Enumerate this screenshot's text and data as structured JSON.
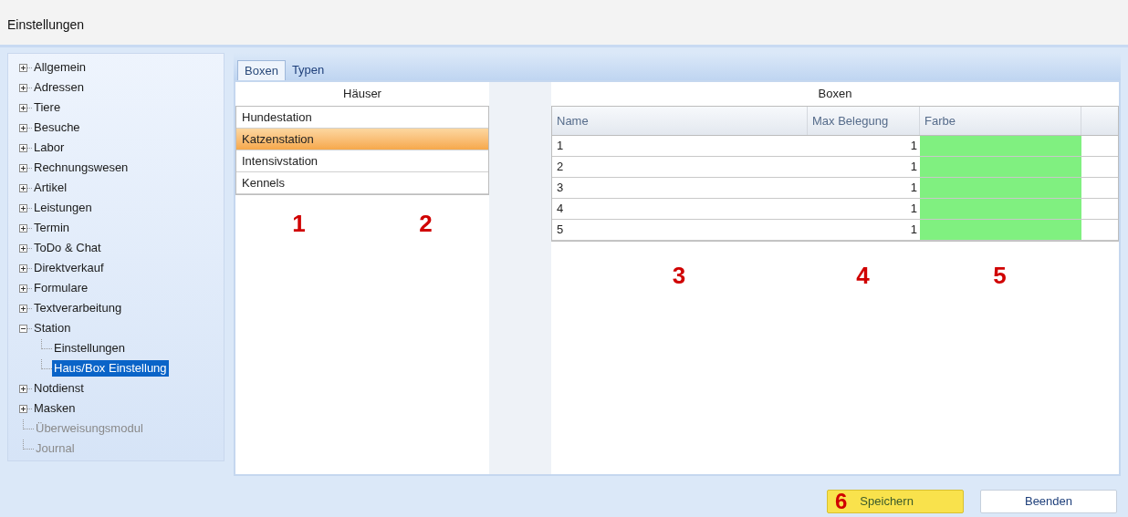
{
  "window": {
    "title": "Einstellungen"
  },
  "tree": [
    {
      "label": "Allgemein",
      "kind": "node",
      "expanded": false,
      "selected": false,
      "disabled": false
    },
    {
      "label": "Adressen",
      "kind": "node",
      "expanded": false,
      "selected": false,
      "disabled": false
    },
    {
      "label": "Tiere",
      "kind": "node",
      "expanded": false,
      "selected": false,
      "disabled": false
    },
    {
      "label": "Besuche",
      "kind": "node",
      "expanded": false,
      "selected": false,
      "disabled": false
    },
    {
      "label": "Labor",
      "kind": "node",
      "expanded": false,
      "selected": false,
      "disabled": false
    },
    {
      "label": "Rechnungswesen",
      "kind": "node",
      "expanded": false,
      "selected": false,
      "disabled": false
    },
    {
      "label": "Artikel",
      "kind": "node",
      "expanded": false,
      "selected": false,
      "disabled": false
    },
    {
      "label": "Leistungen",
      "kind": "node",
      "expanded": false,
      "selected": false,
      "disabled": false
    },
    {
      "label": "Termin",
      "kind": "node",
      "expanded": false,
      "selected": false,
      "disabled": false
    },
    {
      "label": "ToDo & Chat",
      "kind": "node",
      "expanded": false,
      "selected": false,
      "disabled": false
    },
    {
      "label": "Direktverkauf",
      "kind": "node",
      "expanded": false,
      "selected": false,
      "disabled": false
    },
    {
      "label": "Formulare",
      "kind": "node",
      "expanded": false,
      "selected": false,
      "disabled": false
    },
    {
      "label": "Textverarbeitung",
      "kind": "node",
      "expanded": false,
      "selected": false,
      "disabled": false
    },
    {
      "label": "Station",
      "kind": "node",
      "expanded": true,
      "selected": false,
      "disabled": false,
      "children": [
        {
          "label": "Einstellungen",
          "kind": "leaf",
          "selected": false,
          "disabled": false
        },
        {
          "label": "Haus/Box Einstellung",
          "kind": "leaf",
          "selected": true,
          "disabled": false
        }
      ]
    },
    {
      "label": "Notdienst",
      "kind": "node",
      "expanded": false,
      "selected": false,
      "disabled": false
    },
    {
      "label": "Masken",
      "kind": "node",
      "expanded": false,
      "selected": false,
      "disabled": false
    },
    {
      "label": "Überweisungsmodul",
      "kind": "leaf",
      "selected": false,
      "disabled": true
    },
    {
      "label": "Journal",
      "kind": "leaf",
      "selected": false,
      "disabled": true
    }
  ],
  "tabs": [
    {
      "label": "Boxen",
      "selected": true
    },
    {
      "label": "Typen",
      "selected": false
    }
  ],
  "houses": {
    "title": "Häuser",
    "rows": [
      {
        "name": "Hundestation",
        "selected": false
      },
      {
        "name": "Katzenstation",
        "selected": true
      },
      {
        "name": "Intensivstation",
        "selected": false
      },
      {
        "name": "Kennels",
        "selected": false
      }
    ],
    "annotations": [
      "1",
      "2"
    ]
  },
  "boxes": {
    "title": "Boxen",
    "columns": [
      "Name",
      "Max Belegung",
      "Farbe"
    ],
    "rows": [
      {
        "name": "1",
        "max": "1",
        "color": "#80f080"
      },
      {
        "name": "2",
        "max": "1",
        "color": "#80f080"
      },
      {
        "name": "3",
        "max": "1",
        "color": "#80f080"
      },
      {
        "name": "4",
        "max": "1",
        "color": "#80f080"
      },
      {
        "name": "5",
        "max": "1",
        "color": "#80f080"
      }
    ],
    "annotations": [
      "3",
      "4",
      "5"
    ]
  },
  "buttons": [
    {
      "label": "Speichern",
      "annotation": "6",
      "highlighted": true
    },
    {
      "label": "Beenden",
      "highlighted": false
    }
  ]
}
